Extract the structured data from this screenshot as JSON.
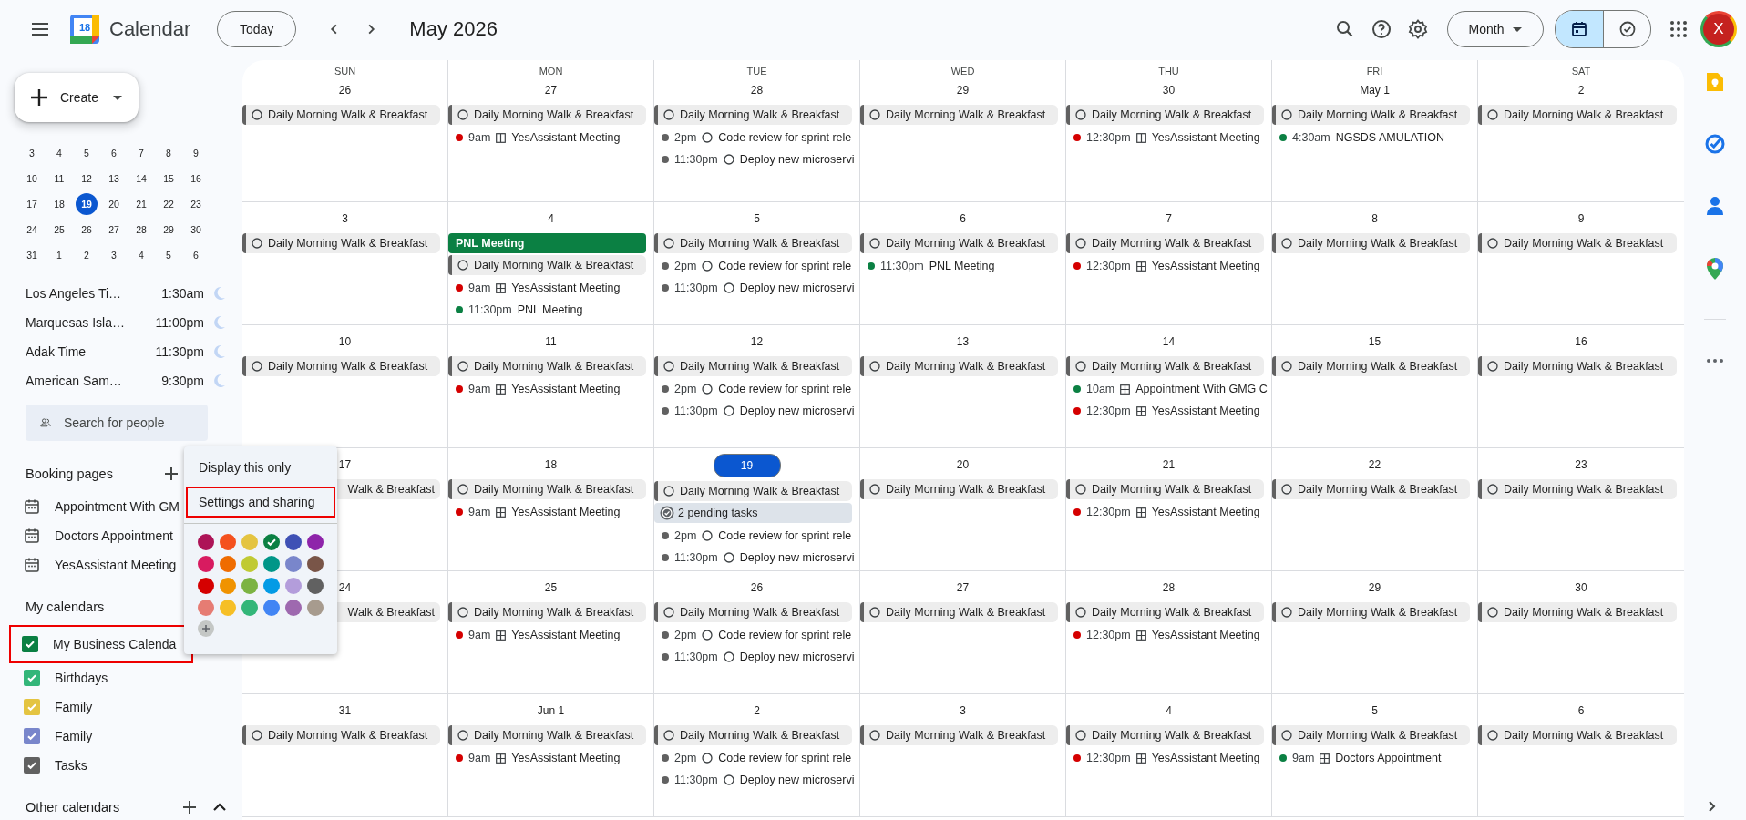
{
  "top_bar": {
    "app_name": "Calendar",
    "logo_day": "18",
    "today_button": "Today",
    "period": "May 2026",
    "view_select": "Month",
    "views": [
      {
        "kind": "calendar",
        "selected": true
      },
      {
        "kind": "tasks",
        "selected": false
      }
    ],
    "avatar": "X"
  },
  "sidebar": {
    "create": "Create",
    "mini_calendar": [
      [
        {
          "label": "3",
          "selected": false
        },
        {
          "label": "4",
          "selected": false
        },
        {
          "label": "5",
          "selected": false
        },
        {
          "label": "6",
          "selected": false
        },
        {
          "label": "7",
          "selected": false
        },
        {
          "label": "8",
          "selected": false
        },
        {
          "label": "9",
          "selected": false
        }
      ],
      [
        {
          "label": "10",
          "selected": false
        },
        {
          "label": "11",
          "selected": false
        },
        {
          "label": "12",
          "selected": false
        },
        {
          "label": "13",
          "selected": false
        },
        {
          "label": "14",
          "selected": false
        },
        {
          "label": "15",
          "selected": false
        },
        {
          "label": "16",
          "selected": false
        }
      ],
      [
        {
          "label": "17",
          "selected": false
        },
        {
          "label": "18",
          "selected": false
        },
        {
          "label": "19",
          "selected": true
        },
        {
          "label": "20",
          "selected": false
        },
        {
          "label": "21",
          "selected": false
        },
        {
          "label": "22",
          "selected": false
        },
        {
          "label": "23",
          "selected": false
        }
      ],
      [
        {
          "label": "24",
          "selected": false
        },
        {
          "label": "25",
          "selected": false
        },
        {
          "label": "26",
          "selected": false
        },
        {
          "label": "27",
          "selected": false
        },
        {
          "label": "28",
          "selected": false
        },
        {
          "label": "29",
          "selected": false
        },
        {
          "label": "30",
          "selected": false
        }
      ],
      [
        {
          "label": "31",
          "selected": false
        },
        {
          "label": "1",
          "selected": false
        },
        {
          "label": "2",
          "selected": false
        },
        {
          "label": "3",
          "selected": false
        },
        {
          "label": "4",
          "selected": false
        },
        {
          "label": "5",
          "selected": false
        },
        {
          "label": "6",
          "selected": false
        }
      ]
    ],
    "timezones": [
      {
        "name": "Los Angeles Ti…",
        "time": "1:30am"
      },
      {
        "name": "Marquesas Isla…",
        "time": "11:00pm"
      },
      {
        "name": "Adak Time",
        "time": "11:30pm"
      },
      {
        "name": "American Sam…",
        "time": "9:30pm"
      }
    ],
    "search_people": {
      "placeholder": "Search for people"
    },
    "booking_pages": {
      "title": "Booking pages",
      "items": [
        "Appointment With GM",
        "Doctors Appointment",
        "YesAssistant Meeting"
      ]
    },
    "my_calendars": {
      "title": "My calendars",
      "items": [
        {
          "name": "My Business Calenda",
          "color": "#0b8043",
          "checked": true,
          "highlighted": true
        },
        {
          "name": "Birthdays",
          "color": "#33b679",
          "checked": true,
          "highlighted": false
        },
        {
          "name": "Family",
          "color": "#e4c441",
          "checked": true,
          "highlighted": false
        },
        {
          "name": "Family",
          "color": "#7986cb",
          "checked": true,
          "highlighted": false
        },
        {
          "name": "Tasks",
          "color": "#616161",
          "checked": true,
          "highlighted": false
        }
      ]
    },
    "other_calendars": {
      "title": "Other calendars",
      "expanded": true
    }
  },
  "popup": {
    "items": [
      {
        "label": "Display this only",
        "highlighted": false
      },
      {
        "label": "Settings and sharing",
        "highlighted": true
      }
    ],
    "colors": [
      {
        "color": "#ad1457",
        "selected": false
      },
      {
        "color": "#f4511e",
        "selected": false
      },
      {
        "color": "#e4c441",
        "selected": false
      },
      {
        "color": "#0b8043",
        "selected": true
      },
      {
        "color": "#3f51b5",
        "selected": false
      },
      {
        "color": "#8e24aa",
        "selected": false
      },
      {
        "color": "#d81b60",
        "selected": false
      },
      {
        "color": "#ef6c00",
        "selected": false
      },
      {
        "color": "#c0ca33",
        "selected": false
      },
      {
        "color": "#009688",
        "selected": false
      },
      {
        "color": "#7986cb",
        "selected": false
      },
      {
        "color": "#795548",
        "selected": false
      },
      {
        "color": "#d50000",
        "selected": false
      },
      {
        "color": "#f09300",
        "selected": false
      },
      {
        "color": "#7cb342",
        "selected": false
      },
      {
        "color": "#039be5",
        "selected": false
      },
      {
        "color": "#b39ddb",
        "selected": false
      },
      {
        "color": "#616161",
        "selected": false
      },
      {
        "color": "#e67c73",
        "selected": false
      },
      {
        "color": "#f6bf26",
        "selected": false
      },
      {
        "color": "#33b679",
        "selected": false
      },
      {
        "color": "#4285f4",
        "selected": false
      },
      {
        "color": "#9e69af",
        "selected": false
      },
      {
        "color": "#a79b8e",
        "selected": false
      }
    ]
  },
  "calendar": {
    "weekdays": [
      "SUN",
      "MON",
      "TUE",
      "WED",
      "THU",
      "FRI",
      "SAT"
    ],
    "weeks": [
      {
        "days": [
          {
            "date": "26",
            "today": false,
            "events": [
              {
                "kind": "allday",
                "title": "Daily Morning Walk & Breakfast"
              }
            ]
          },
          {
            "date": "27",
            "today": false,
            "events": [
              {
                "kind": "allday",
                "title": "Daily Morning Walk & Breakfast"
              },
              {
                "kind": "booking",
                "color": "#d50000",
                "time": "9am",
                "title": "YesAssistant Meeting"
              }
            ]
          },
          {
            "date": "28",
            "today": false,
            "events": [
              {
                "kind": "allday",
                "title": "Daily Morning Walk & Breakfast"
              },
              {
                "kind": "task",
                "color": "#616161",
                "time": "2pm",
                "title": "Code review for sprint rele"
              },
              {
                "kind": "task",
                "color": "#616161",
                "time": "11:30pm",
                "title": "Deploy new microservi"
              }
            ]
          },
          {
            "date": "29",
            "today": false,
            "events": [
              {
                "kind": "allday",
                "title": "Daily Morning Walk & Breakfast"
              }
            ]
          },
          {
            "date": "30",
            "today": false,
            "events": [
              {
                "kind": "allday",
                "title": "Daily Morning Walk & Breakfast"
              },
              {
                "kind": "booking",
                "color": "#d50000",
                "time": "12:30pm",
                "title": "YesAssistant Meeting"
              }
            ]
          },
          {
            "date": "May 1",
            "today": false,
            "events": [
              {
                "kind": "allday",
                "title": "Daily Morning Walk & Breakfast"
              },
              {
                "kind": "event",
                "color": "#0b8043",
                "time": "4:30am",
                "title": "NGSDS AMULATION"
              }
            ]
          },
          {
            "date": "2",
            "today": false,
            "events": [
              {
                "kind": "allday",
                "title": "Daily Morning Walk & Breakfast"
              }
            ]
          }
        ]
      },
      {
        "days": [
          {
            "date": "3",
            "today": false,
            "events": [
              {
                "kind": "allday",
                "title": "Daily Morning Walk & Breakfast"
              }
            ]
          },
          {
            "date": "4",
            "today": false,
            "events": [
              {
                "kind": "block",
                "color": "#0b8043",
                "title": "PNL Meeting"
              },
              {
                "kind": "allday",
                "title": "Daily Morning Walk & Breakfast"
              },
              {
                "kind": "booking",
                "color": "#d50000",
                "time": "9am",
                "title": "YesAssistant Meeting"
              },
              {
                "kind": "event",
                "color": "#0b8043",
                "time": "11:30pm",
                "title": "PNL Meeting"
              }
            ]
          },
          {
            "date": "5",
            "today": false,
            "events": [
              {
                "kind": "allday",
                "title": "Daily Morning Walk & Breakfast"
              },
              {
                "kind": "task",
                "color": "#616161",
                "time": "2pm",
                "title": "Code review for sprint rele"
              },
              {
                "kind": "task",
                "color": "#616161",
                "time": "11:30pm",
                "title": "Deploy new microservi"
              }
            ]
          },
          {
            "date": "6",
            "today": false,
            "events": [
              {
                "kind": "allday",
                "title": "Daily Morning Walk & Breakfast"
              },
              {
                "kind": "event",
                "color": "#0b8043",
                "time": "11:30pm",
                "title": "PNL Meeting"
              }
            ]
          },
          {
            "date": "7",
            "today": false,
            "events": [
              {
                "kind": "allday",
                "title": "Daily Morning Walk & Breakfast"
              },
              {
                "kind": "booking",
                "color": "#d50000",
                "time": "12:30pm",
                "title": "YesAssistant Meeting"
              }
            ]
          },
          {
            "date": "8",
            "today": false,
            "events": [
              {
                "kind": "allday",
                "title": "Daily Morning Walk & Breakfast"
              }
            ]
          },
          {
            "date": "9",
            "today": false,
            "events": [
              {
                "kind": "allday",
                "title": "Daily Morning Walk & Breakfast"
              }
            ]
          }
        ]
      },
      {
        "days": [
          {
            "date": "10",
            "today": false,
            "events": [
              {
                "kind": "allday",
                "title": "Daily Morning Walk & Breakfast"
              }
            ]
          },
          {
            "date": "11",
            "today": false,
            "events": [
              {
                "kind": "allday",
                "title": "Daily Morning Walk & Breakfast"
              },
              {
                "kind": "booking",
                "color": "#d50000",
                "time": "9am",
                "title": "YesAssistant Meeting"
              }
            ]
          },
          {
            "date": "12",
            "today": false,
            "events": [
              {
                "kind": "allday",
                "title": "Daily Morning Walk & Breakfast"
              },
              {
                "kind": "task",
                "color": "#616161",
                "time": "2pm",
                "title": "Code review for sprint rele"
              },
              {
                "kind": "task",
                "color": "#616161",
                "time": "11:30pm",
                "title": "Deploy new microservi"
              }
            ]
          },
          {
            "date": "13",
            "today": false,
            "events": [
              {
                "kind": "allday",
                "title": "Daily Morning Walk & Breakfast"
              }
            ]
          },
          {
            "date": "14",
            "today": false,
            "events": [
              {
                "kind": "allday",
                "title": "Daily Morning Walk & Breakfast"
              },
              {
                "kind": "booking",
                "color": "#0b8043",
                "time": "10am",
                "title": "Appointment With GMG C"
              },
              {
                "kind": "booking",
                "color": "#d50000",
                "time": "12:30pm",
                "title": "YesAssistant Meeting"
              }
            ]
          },
          {
            "date": "15",
            "today": false,
            "events": [
              {
                "kind": "allday",
                "title": "Daily Morning Walk & Breakfast"
              }
            ]
          },
          {
            "date": "16",
            "today": false,
            "events": [
              {
                "kind": "allday",
                "title": "Daily Morning Walk & Breakfast"
              }
            ]
          }
        ]
      },
      {
        "days": [
          {
            "date": "17",
            "today": false,
            "events": [
              {
                "kind": "allday-covered",
                "title": "Walk & Breakfast"
              }
            ]
          },
          {
            "date": "18",
            "today": false,
            "events": [
              {
                "kind": "allday",
                "title": "Daily Morning Walk & Breakfast"
              },
              {
                "kind": "booking",
                "color": "#d50000",
                "time": "9am",
                "title": "YesAssistant Meeting"
              }
            ]
          },
          {
            "date": "19",
            "today": true,
            "events": [
              {
                "kind": "allday",
                "title": "Daily Morning Walk & Breakfast"
              },
              {
                "kind": "summary",
                "title": "2 pending tasks"
              },
              {
                "kind": "task",
                "color": "#616161",
                "time": "2pm",
                "title": "Code review for sprint rele"
              },
              {
                "kind": "task",
                "color": "#616161",
                "time": "11:30pm",
                "title": "Deploy new microservi"
              }
            ]
          },
          {
            "date": "20",
            "today": false,
            "events": [
              {
                "kind": "allday",
                "title": "Daily Morning Walk & Breakfast"
              }
            ]
          },
          {
            "date": "21",
            "today": false,
            "events": [
              {
                "kind": "allday",
                "title": "Daily Morning Walk & Breakfast"
              },
              {
                "kind": "booking",
                "color": "#d50000",
                "time": "12:30pm",
                "title": "YesAssistant Meeting"
              }
            ]
          },
          {
            "date": "22",
            "today": false,
            "events": [
              {
                "kind": "allday",
                "title": "Daily Morning Walk & Breakfast"
              }
            ]
          },
          {
            "date": "23",
            "today": false,
            "events": [
              {
                "kind": "allday",
                "title": "Daily Morning Walk & Breakfast"
              }
            ]
          }
        ]
      },
      {
        "days": [
          {
            "date": "24",
            "today": false,
            "events": [
              {
                "kind": "allday-covered",
                "title": "Walk & Breakfast"
              }
            ]
          },
          {
            "date": "25",
            "today": false,
            "events": [
              {
                "kind": "allday",
                "title": "Daily Morning Walk & Breakfast"
              },
              {
                "kind": "booking",
                "color": "#d50000",
                "time": "9am",
                "title": "YesAssistant Meeting"
              }
            ]
          },
          {
            "date": "26",
            "today": false,
            "events": [
              {
                "kind": "allday",
                "title": "Daily Morning Walk & Breakfast"
              },
              {
                "kind": "task",
                "color": "#616161",
                "time": "2pm",
                "title": "Code review for sprint rele"
              },
              {
                "kind": "task",
                "color": "#616161",
                "time": "11:30pm",
                "title": "Deploy new microservi"
              }
            ]
          },
          {
            "date": "27",
            "today": false,
            "events": [
              {
                "kind": "allday",
                "title": "Daily Morning Walk & Breakfast"
              }
            ]
          },
          {
            "date": "28",
            "today": false,
            "events": [
              {
                "kind": "allday",
                "title": "Daily Morning Walk & Breakfast"
              },
              {
                "kind": "booking",
                "color": "#d50000",
                "time": "12:30pm",
                "title": "YesAssistant Meeting"
              }
            ]
          },
          {
            "date": "29",
            "today": false,
            "events": [
              {
                "kind": "allday",
                "title": "Daily Morning Walk & Breakfast"
              }
            ]
          },
          {
            "date": "30",
            "today": false,
            "events": [
              {
                "kind": "allday",
                "title": "Daily Morning Walk & Breakfast"
              }
            ]
          }
        ]
      },
      {
        "days": [
          {
            "date": "31",
            "today": false,
            "events": [
              {
                "kind": "allday",
                "title": "Daily Morning Walk & Breakfast"
              }
            ]
          },
          {
            "date": "Jun 1",
            "today": false,
            "events": [
              {
                "kind": "allday",
                "title": "Daily Morning Walk & Breakfast"
              },
              {
                "kind": "booking",
                "color": "#d50000",
                "time": "9am",
                "title": "YesAssistant Meeting"
              }
            ]
          },
          {
            "date": "2",
            "today": false,
            "events": [
              {
                "kind": "allday",
                "title": "Daily Morning Walk & Breakfast"
              },
              {
                "kind": "task",
                "color": "#616161",
                "time": "2pm",
                "title": "Code review for sprint rele"
              },
              {
                "kind": "task",
                "color": "#616161",
                "time": "11:30pm",
                "title": "Deploy new microservi"
              }
            ]
          },
          {
            "date": "3",
            "today": false,
            "events": [
              {
                "kind": "allday",
                "title": "Daily Morning Walk & Breakfast"
              }
            ]
          },
          {
            "date": "4",
            "today": false,
            "events": [
              {
                "kind": "allday",
                "title": "Daily Morning Walk & Breakfast"
              },
              {
                "kind": "booking",
                "color": "#d50000",
                "time": "12:30pm",
                "title": "YesAssistant Meeting"
              }
            ]
          },
          {
            "date": "5",
            "today": false,
            "events": [
              {
                "kind": "allday",
                "title": "Daily Morning Walk & Breakfast"
              },
              {
                "kind": "booking",
                "color": "#0b8043",
                "time": "9am",
                "title": "Doctors Appointment"
              }
            ]
          },
          {
            "date": "6",
            "today": false,
            "events": [
              {
                "kind": "allday",
                "title": "Daily Morning Walk & Breakfast"
              }
            ]
          }
        ]
      }
    ]
  }
}
